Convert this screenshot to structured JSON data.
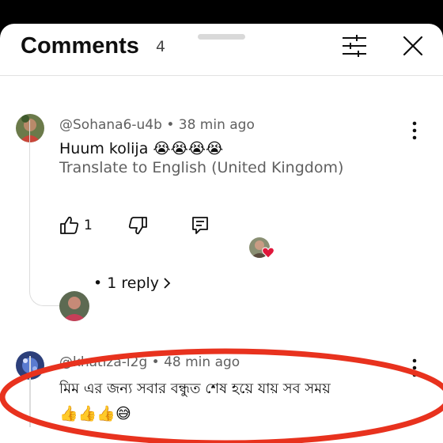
{
  "header": {
    "title": "Comments",
    "count": "4"
  },
  "comments": [
    {
      "author": "@Sohana6-u4b",
      "time": "38 min ago",
      "text": "Huum kolija 😭😭😭😭",
      "translate_label": "Translate to English (United Kingdom)",
      "like_count": "1",
      "reply_label": "1 reply"
    },
    {
      "author": "@khatiza-l2g",
      "time": "48 min ago",
      "text_line1": "মিম এর জন্য সবার বন্ধুত শেষ হয়ে যায় সব সময়",
      "text_line2": "👍👍👍😅"
    }
  ],
  "icons": {
    "filter": "sliders-icon",
    "close": "close-icon",
    "more": "more-vertical-icon",
    "like": "thumbs-up-icon",
    "dislike": "thumbs-down-icon",
    "reply": "comment-reply-icon",
    "creator_heart": "heart-icon",
    "chevron": "chevron-right-icon"
  },
  "colors": {
    "annotation_ellipse": "#e8321e",
    "heart": "#e0173b"
  }
}
